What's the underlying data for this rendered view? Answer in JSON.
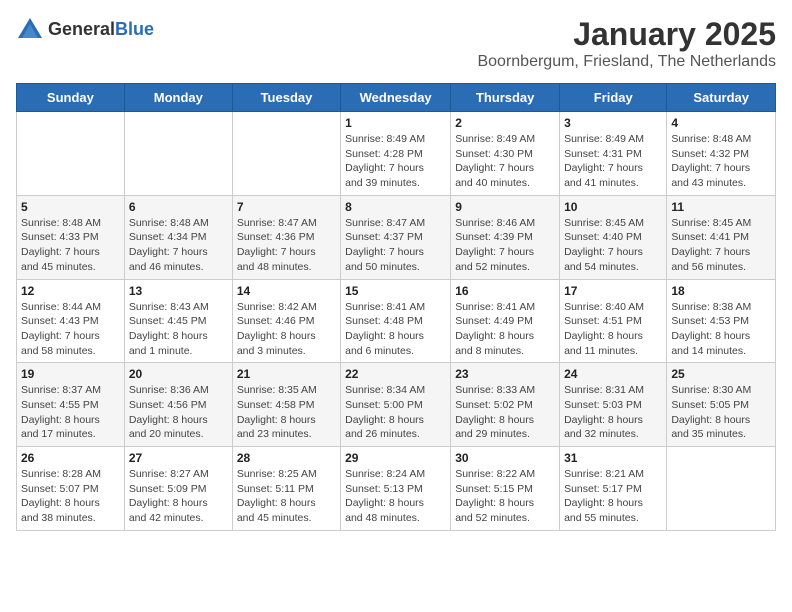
{
  "header": {
    "logo_general": "General",
    "logo_blue": "Blue",
    "title": "January 2025",
    "subtitle": "Boornbergum, Friesland, The Netherlands"
  },
  "weekdays": [
    "Sunday",
    "Monday",
    "Tuesday",
    "Wednesday",
    "Thursday",
    "Friday",
    "Saturday"
  ],
  "weeks": [
    [
      {
        "day": "",
        "detail": ""
      },
      {
        "day": "",
        "detail": ""
      },
      {
        "day": "",
        "detail": ""
      },
      {
        "day": "1",
        "detail": "Sunrise: 8:49 AM\nSunset: 4:28 PM\nDaylight: 7 hours\nand 39 minutes."
      },
      {
        "day": "2",
        "detail": "Sunrise: 8:49 AM\nSunset: 4:30 PM\nDaylight: 7 hours\nand 40 minutes."
      },
      {
        "day": "3",
        "detail": "Sunrise: 8:49 AM\nSunset: 4:31 PM\nDaylight: 7 hours\nand 41 minutes."
      },
      {
        "day": "4",
        "detail": "Sunrise: 8:48 AM\nSunset: 4:32 PM\nDaylight: 7 hours\nand 43 minutes."
      }
    ],
    [
      {
        "day": "5",
        "detail": "Sunrise: 8:48 AM\nSunset: 4:33 PM\nDaylight: 7 hours\nand 45 minutes."
      },
      {
        "day": "6",
        "detail": "Sunrise: 8:48 AM\nSunset: 4:34 PM\nDaylight: 7 hours\nand 46 minutes."
      },
      {
        "day": "7",
        "detail": "Sunrise: 8:47 AM\nSunset: 4:36 PM\nDaylight: 7 hours\nand 48 minutes."
      },
      {
        "day": "8",
        "detail": "Sunrise: 8:47 AM\nSunset: 4:37 PM\nDaylight: 7 hours\nand 50 minutes."
      },
      {
        "day": "9",
        "detail": "Sunrise: 8:46 AM\nSunset: 4:39 PM\nDaylight: 7 hours\nand 52 minutes."
      },
      {
        "day": "10",
        "detail": "Sunrise: 8:45 AM\nSunset: 4:40 PM\nDaylight: 7 hours\nand 54 minutes."
      },
      {
        "day": "11",
        "detail": "Sunrise: 8:45 AM\nSunset: 4:41 PM\nDaylight: 7 hours\nand 56 minutes."
      }
    ],
    [
      {
        "day": "12",
        "detail": "Sunrise: 8:44 AM\nSunset: 4:43 PM\nDaylight: 7 hours\nand 58 minutes."
      },
      {
        "day": "13",
        "detail": "Sunrise: 8:43 AM\nSunset: 4:45 PM\nDaylight: 8 hours\nand 1 minute."
      },
      {
        "day": "14",
        "detail": "Sunrise: 8:42 AM\nSunset: 4:46 PM\nDaylight: 8 hours\nand 3 minutes."
      },
      {
        "day": "15",
        "detail": "Sunrise: 8:41 AM\nSunset: 4:48 PM\nDaylight: 8 hours\nand 6 minutes."
      },
      {
        "day": "16",
        "detail": "Sunrise: 8:41 AM\nSunset: 4:49 PM\nDaylight: 8 hours\nand 8 minutes."
      },
      {
        "day": "17",
        "detail": "Sunrise: 8:40 AM\nSunset: 4:51 PM\nDaylight: 8 hours\nand 11 minutes."
      },
      {
        "day": "18",
        "detail": "Sunrise: 8:38 AM\nSunset: 4:53 PM\nDaylight: 8 hours\nand 14 minutes."
      }
    ],
    [
      {
        "day": "19",
        "detail": "Sunrise: 8:37 AM\nSunset: 4:55 PM\nDaylight: 8 hours\nand 17 minutes."
      },
      {
        "day": "20",
        "detail": "Sunrise: 8:36 AM\nSunset: 4:56 PM\nDaylight: 8 hours\nand 20 minutes."
      },
      {
        "day": "21",
        "detail": "Sunrise: 8:35 AM\nSunset: 4:58 PM\nDaylight: 8 hours\nand 23 minutes."
      },
      {
        "day": "22",
        "detail": "Sunrise: 8:34 AM\nSunset: 5:00 PM\nDaylight: 8 hours\nand 26 minutes."
      },
      {
        "day": "23",
        "detail": "Sunrise: 8:33 AM\nSunset: 5:02 PM\nDaylight: 8 hours\nand 29 minutes."
      },
      {
        "day": "24",
        "detail": "Sunrise: 8:31 AM\nSunset: 5:03 PM\nDaylight: 8 hours\nand 32 minutes."
      },
      {
        "day": "25",
        "detail": "Sunrise: 8:30 AM\nSunset: 5:05 PM\nDaylight: 8 hours\nand 35 minutes."
      }
    ],
    [
      {
        "day": "26",
        "detail": "Sunrise: 8:28 AM\nSunset: 5:07 PM\nDaylight: 8 hours\nand 38 minutes."
      },
      {
        "day": "27",
        "detail": "Sunrise: 8:27 AM\nSunset: 5:09 PM\nDaylight: 8 hours\nand 42 minutes."
      },
      {
        "day": "28",
        "detail": "Sunrise: 8:25 AM\nSunset: 5:11 PM\nDaylight: 8 hours\nand 45 minutes."
      },
      {
        "day": "29",
        "detail": "Sunrise: 8:24 AM\nSunset: 5:13 PM\nDaylight: 8 hours\nand 48 minutes."
      },
      {
        "day": "30",
        "detail": "Sunrise: 8:22 AM\nSunset: 5:15 PM\nDaylight: 8 hours\nand 52 minutes."
      },
      {
        "day": "31",
        "detail": "Sunrise: 8:21 AM\nSunset: 5:17 PM\nDaylight: 8 hours\nand 55 minutes."
      },
      {
        "day": "",
        "detail": ""
      }
    ]
  ]
}
